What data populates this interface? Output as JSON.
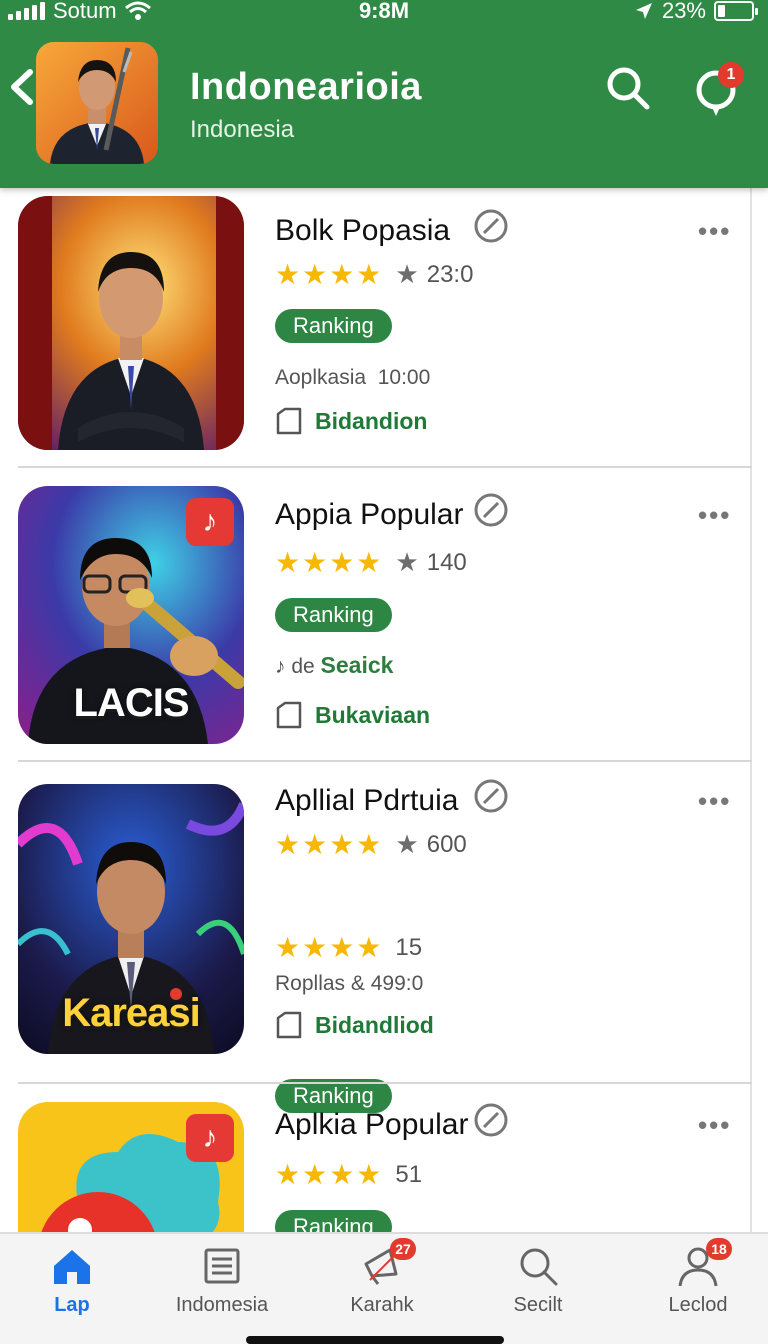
{
  "status_bar": {
    "carrier": "Sotum",
    "time": "9:8M",
    "battery": "23%",
    "battery_level": 0.23
  },
  "header": {
    "title": "Indonearioia",
    "subtitle": "Indonesia",
    "notification_count": "1"
  },
  "apps": [
    {
      "title": "Bolk Popasia",
      "stars": 4,
      "rating": "23:0",
      "chip": "Ranking",
      "meta": "Aoplkasia  10:00",
      "download_label": "Bidandion",
      "thumb_caption": ""
    },
    {
      "title": "Appia Popular",
      "stars": 4,
      "rating": "140",
      "chip": "Ranking",
      "meta_icon": "♪",
      "meta_plain": "de",
      "meta_green": "Seaick",
      "download_label": "Bukaviaan",
      "thumb_caption": "LACIS"
    },
    {
      "title": "Apllial Pdrtuia",
      "stars": 4,
      "rating": "600",
      "chip": "Ranking",
      "second_stars": 4,
      "second_rating": "15",
      "meta": "Ropllas & 499:0",
      "download_label": "Bidandliod",
      "thumb_caption": "Kareasi"
    },
    {
      "title": "Aplkia Popular",
      "stars": 4,
      "rating": "51",
      "chip": "Ranking",
      "thumb_caption": ""
    }
  ],
  "bottom_nav": [
    {
      "label": "Lap",
      "icon": "home-icon",
      "active": true
    },
    {
      "label": "Indomesia",
      "icon": "document-icon"
    },
    {
      "label": "Karahk",
      "icon": "megaphone-icon",
      "badge": "27"
    },
    {
      "label": "Secilt",
      "icon": "search-icon"
    },
    {
      "label": "Leclod",
      "icon": "person-icon",
      "badge": "18"
    }
  ],
  "colors": {
    "header_green": "#2f8a45",
    "star_gold": "#f6b800",
    "chip_green": "#2e8645",
    "badge_red": "#e23b2e",
    "nav_active": "#1a73e8"
  }
}
